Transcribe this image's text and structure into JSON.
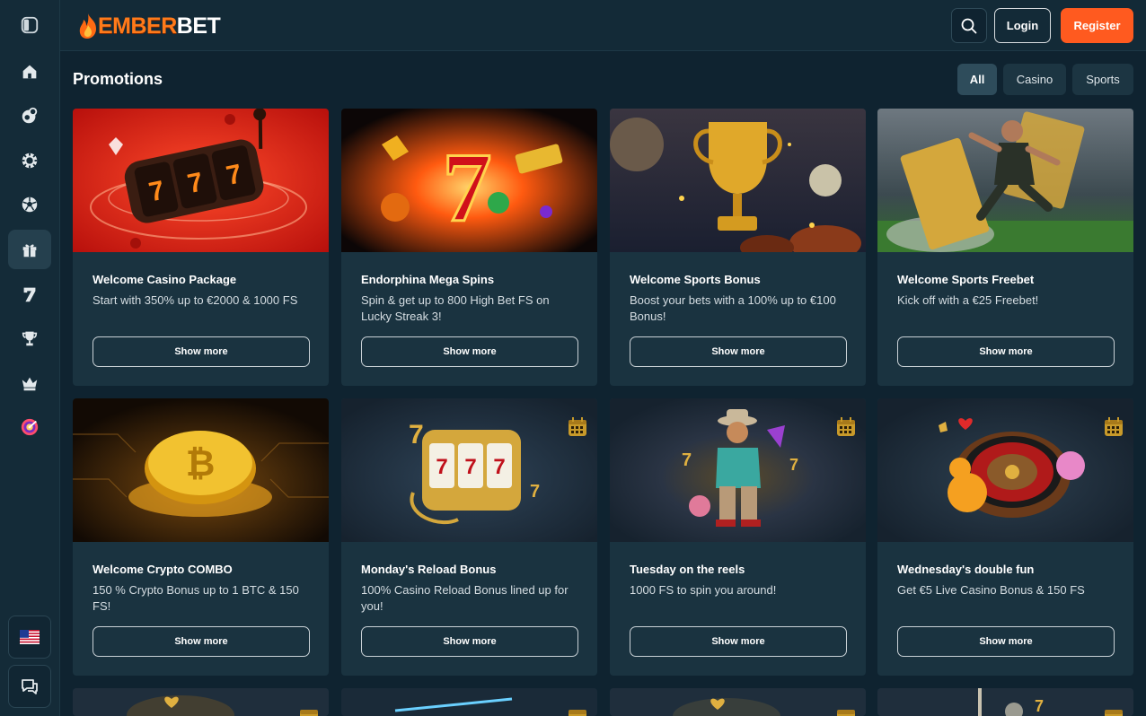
{
  "brand": {
    "name_part1": "EMBER",
    "name_part2": "BET"
  },
  "header": {
    "login_label": "Login",
    "register_label": "Register"
  },
  "page": {
    "title": "Promotions"
  },
  "filters": [
    {
      "label": "All",
      "active": true
    },
    {
      "label": "Casino",
      "active": false
    },
    {
      "label": "Sports",
      "active": false
    }
  ],
  "sidebar": {
    "items": [
      {
        "icon": "sidebar-toggle-icon"
      },
      {
        "icon": "home-icon"
      },
      {
        "icon": "live-casino-icon"
      },
      {
        "icon": "casino-chip-icon"
      },
      {
        "icon": "sports-ball-icon"
      },
      {
        "icon": "gift-icon",
        "active": true
      },
      {
        "icon": "seven-icon"
      },
      {
        "icon": "trophy-icon"
      },
      {
        "icon": "crown-icon"
      },
      {
        "icon": "wheel-icon"
      }
    ],
    "language_icon": "us-flag-icon",
    "chat_icon": "chat-icon"
  },
  "promotions": [
    {
      "title": "Welcome Casino Package",
      "description": "Start with 350% up to €2000 & 1000 FS",
      "button": "Show more"
    },
    {
      "title": "Endorphina Mega Spins",
      "description": "Spin & get up to 800 High Bet FS on Lucky Streak 3!",
      "button": "Show more"
    },
    {
      "title": "Welcome Sports Bonus",
      "description": "Boost your bets with a 100% up to €100 Bonus!",
      "button": "Show more"
    },
    {
      "title": "Welcome Sports Freebet",
      "description": "Kick off with a €25 Freebet!",
      "button": "Show more"
    },
    {
      "title": "Welcome Crypto COMBO",
      "description": "150 % Crypto Bonus up to 1 BTC & 150 FS!",
      "button": "Show more"
    },
    {
      "title": "Monday's Reload Bonus",
      "description": "100% Casino Reload Bonus lined up for you!",
      "button": "Show more"
    },
    {
      "title": "Tuesday on the reels",
      "description": "1000 FS to spin you around!",
      "button": "Show more"
    },
    {
      "title": "Wednesday's double fun",
      "description": "Get €5 Live Casino Bonus & 150 FS",
      "button": "Show more"
    }
  ],
  "colors": {
    "accent": "#ff5a1f",
    "background": "#0f2330",
    "card": "#1a3340"
  }
}
